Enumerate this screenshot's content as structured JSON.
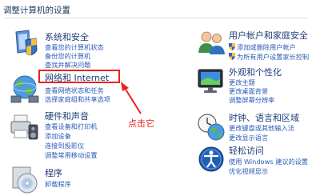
{
  "header": {
    "title": "调整计算机的设置"
  },
  "left_categories": [
    {
      "id": "system-security",
      "title": "系统和安全",
      "links": [
        "查看您的计算机状态",
        "备份您的计算机",
        "查找并解决问题"
      ]
    },
    {
      "id": "network-internet",
      "title": "网络和 Internet",
      "links": [
        "查看网络状态和任务",
        "选择家庭组和共享选项"
      ]
    },
    {
      "id": "hardware-sound",
      "title": "硬件和声音",
      "links": [
        "查看设备和打印机",
        "添加设备",
        "连接到投影仪",
        "调整常用移动设置"
      ]
    },
    {
      "id": "programs",
      "title": "程序",
      "links": [
        "卸载程序"
      ]
    }
  ],
  "right_categories": [
    {
      "id": "user-accounts",
      "title": "用户帐户和家庭安全",
      "links": [
        "添加或删除用户帐户",
        "为所有用户设置家长控制"
      ]
    },
    {
      "id": "appearance",
      "title": "外观和个性化",
      "links": [
        "更改主题",
        "更改桌面背景",
        "调整屏幕分辨率"
      ]
    },
    {
      "id": "clock-region",
      "title": "时钟、语言和区域",
      "links": [
        "更改键盘或其他输入法",
        "更改显示语言"
      ]
    },
    {
      "id": "ease-of-access",
      "title": "轻松访问",
      "links": [
        "使用 Windows 建议的设置",
        "优化视频显示"
      ]
    }
  ],
  "annotation": {
    "text": "点击它",
    "color": "#e8231d"
  },
  "colors": {
    "title": "#1e395b",
    "category": "#1e3d78",
    "link": "#2a5bb8",
    "annotation": "#e8231d"
  },
  "icons": [
    "system-security-icon",
    "network-globe-icon",
    "hardware-printer-icon",
    "programs-disc-icon",
    "users-icon",
    "appearance-monitor-icon",
    "clock-globe-icon",
    "ease-of-access-icon",
    "uac-shield-icon"
  ]
}
